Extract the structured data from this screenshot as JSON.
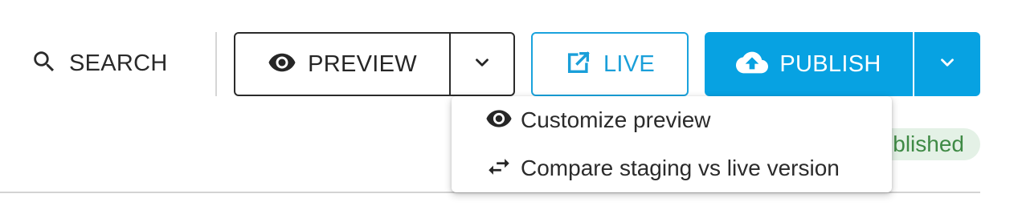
{
  "toolbar": {
    "search_label": "SEARCH",
    "preview_label": "PREVIEW",
    "live_label": "LIVE",
    "publish_label": "PUBLISH"
  },
  "preview_menu": {
    "items": [
      {
        "label": "Customize preview",
        "icon": "eye-icon"
      },
      {
        "label": "Compare staging vs live version",
        "icon": "swap-arrows-icon"
      }
    ]
  },
  "status": {
    "text": "Published"
  },
  "colors": {
    "accent": "#07a2e2",
    "live_border": "#1aa3dd",
    "status_bg": "#e4f1e6",
    "status_text": "#3f8a45",
    "dark": "#262626"
  },
  "icons": {
    "search": "search-icon",
    "preview": "eye-icon",
    "preview_caret": "chevron-down-icon",
    "live": "external-link-icon",
    "publish": "cloud-upload-icon",
    "publish_caret": "chevron-down-icon"
  }
}
